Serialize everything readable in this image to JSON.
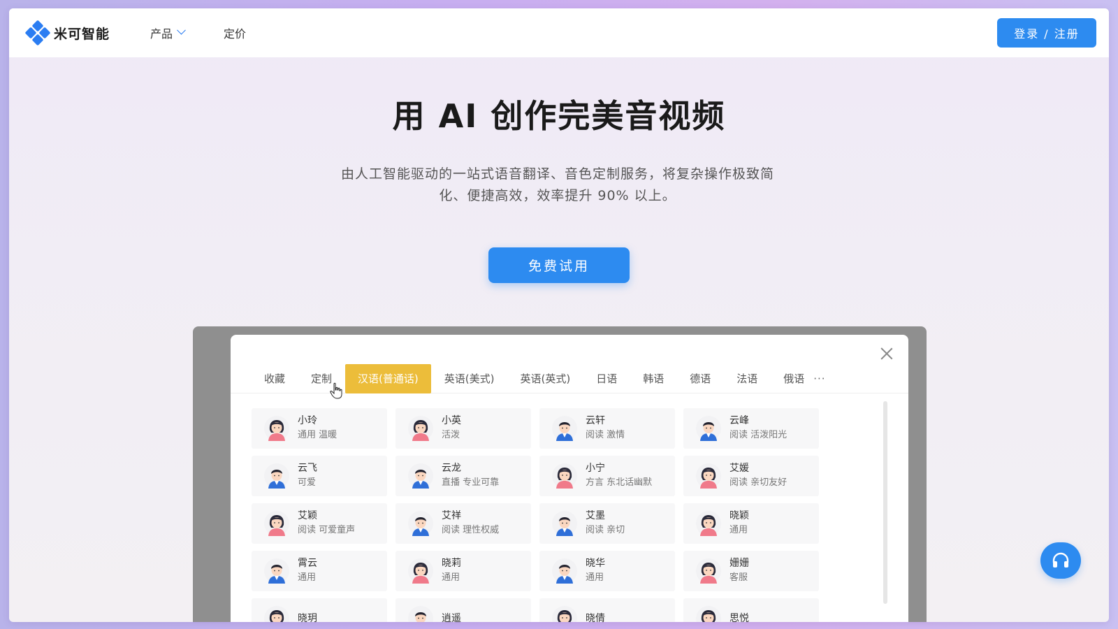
{
  "brand": {
    "name": "米可智能",
    "color": "#2b7df2"
  },
  "nav": {
    "items": [
      {
        "label": "产品",
        "has_dropdown": true
      },
      {
        "label": "定价",
        "has_dropdown": false
      }
    ],
    "login_label": "登录 / 注册"
  },
  "hero": {
    "title": "用 AI 创作完美音视频",
    "subtitle_line1": "由人工智能驱动的一站式语音翻译、音色定制服务，将复杂操作极致简",
    "subtitle_line2": "化、便捷高效，效率提升 90% 以上。",
    "cta_label": "免费试用"
  },
  "voice_dialog": {
    "tabs": [
      {
        "label": "收藏"
      },
      {
        "label": "定制"
      },
      {
        "label": "汉语(普通话)",
        "active": true
      },
      {
        "label": "英语(美式)"
      },
      {
        "label": "英语(英式)"
      },
      {
        "label": "日语"
      },
      {
        "label": "韩语"
      },
      {
        "label": "德语"
      },
      {
        "label": "法语"
      },
      {
        "label": "俄语"
      }
    ],
    "more_label": "···",
    "active_tab_color": "#ecbd3a",
    "voices": [
      {
        "name": "小玲",
        "tags": "通用 温暖",
        "gender": "female"
      },
      {
        "name": "小英",
        "tags": "活泼",
        "gender": "female"
      },
      {
        "name": "云轩",
        "tags": "阅读 激情",
        "gender": "male"
      },
      {
        "name": "云峰",
        "tags": "阅读 活泼阳光",
        "gender": "male"
      },
      {
        "name": "云飞",
        "tags": "可爱",
        "gender": "male"
      },
      {
        "name": "云龙",
        "tags": "直播 专业可靠",
        "gender": "male"
      },
      {
        "name": "小宁",
        "tags": "方言 东北话幽默",
        "gender": "female"
      },
      {
        "name": "艾媛",
        "tags": "阅读 亲切友好",
        "gender": "female"
      },
      {
        "name": "艾颖",
        "tags": "阅读 可爱童声",
        "gender": "female"
      },
      {
        "name": "艾祥",
        "tags": "阅读 理性权威",
        "gender": "male"
      },
      {
        "name": "艾墨",
        "tags": "阅读 亲切",
        "gender": "male"
      },
      {
        "name": "晓颖",
        "tags": "通用",
        "gender": "female"
      },
      {
        "name": "霄云",
        "tags": "通用",
        "gender": "male"
      },
      {
        "name": "晓莉",
        "tags": "通用",
        "gender": "female"
      },
      {
        "name": "晓华",
        "tags": "通用",
        "gender": "male"
      },
      {
        "name": "姗姗",
        "tags": "客服",
        "gender": "female"
      },
      {
        "name": "晓玥",
        "tags": "",
        "gender": "female"
      },
      {
        "name": "逍遥",
        "tags": "",
        "gender": "male"
      },
      {
        "name": "晓倩",
        "tags": "",
        "gender": "female"
      },
      {
        "name": "思悦",
        "tags": "",
        "gender": "female"
      }
    ]
  },
  "support": {
    "icon": "headset-icon"
  }
}
